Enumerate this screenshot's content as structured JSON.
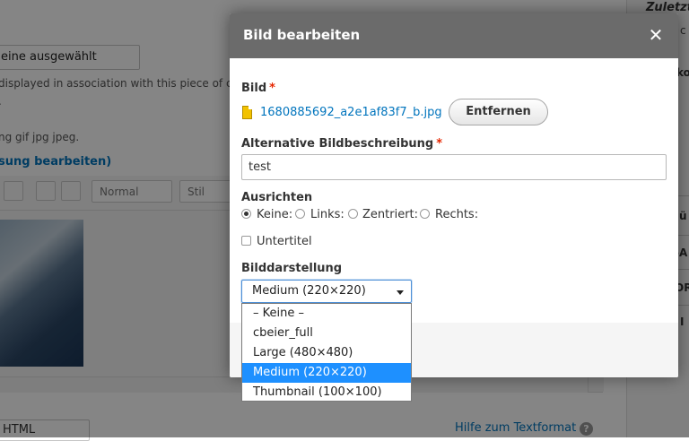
{
  "background": {
    "image_field_value": "eine ausgewählt",
    "desc_line1": "displayed in association with this piece of c",
    "desc_line2": ".",
    "desc_line3": "ng gif jpg jpeg.",
    "edit_link": "sung bearbeiten)",
    "toolbar_format": "Normal",
    "toolbar_style": "Stil",
    "text_format": "HTML",
    "help_link": "Hilfe zum Textformat",
    "help_icon": "?",
    "sidebar": {
      "title": "Zuletzt",
      "lines": [
        "c",
        "ko",
        "ü",
        "-A",
        "OR",
        "I"
      ]
    }
  },
  "dialog": {
    "title": "Bild bearbeiten",
    "close_icon": "✕",
    "image_label": "Bild",
    "required_mark": "*",
    "file_name": "1680885692_a2e1af83f7_b.jpg",
    "remove_button": "Entfernen",
    "alt_label": "Alternative Bildbeschreibung",
    "alt_value": "test",
    "align_label": "Ausrichten",
    "align_options": [
      "Keine:",
      "Links:",
      "Zentriert:",
      "Rechts:"
    ],
    "align_selected": "Keine:",
    "caption_label": "Untertitel",
    "caption_checked": false,
    "style_label": "Bilddarstellung",
    "style_selected": "Medium (220×220)",
    "style_options": [
      "– Keine –",
      "cbeier_full",
      "Large (480×480)",
      "Medium (220×220)",
      "Thumbnail (100×100)"
    ],
    "highlight_color": "#1e90ff",
    "header_color": "#6b6b6b"
  }
}
